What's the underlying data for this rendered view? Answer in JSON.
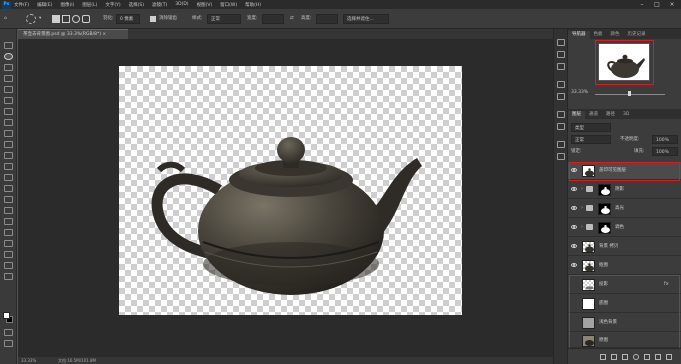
{
  "app": {
    "logo": "Ps",
    "menu": [
      "文件(F)",
      "编辑(E)",
      "图像(I)",
      "图层(L)",
      "文字(Y)",
      "选择(S)",
      "滤镜(T)",
      "3D(D)",
      "视图(V)",
      "窗口(W)",
      "帮助(H)"
    ]
  },
  "options_bar": {
    "feather_label": "羽化:",
    "feather_value": "0 像素",
    "antialias_label": "消除锯齿",
    "style_label": "样式:",
    "style_value": "正常",
    "width_label": "宽度:",
    "height_label": "高度:",
    "select_mask_button": "选择并遮住..."
  },
  "document": {
    "tab_title": "茶壶去背景图.psd @ 33.3%(RGB/8*) ×",
    "status_zoom": "33.33%",
    "status_doc": "文档:16.5M/101.8M"
  },
  "navigator": {
    "tabs": [
      "导航器",
      "色板",
      "颜色",
      "历史记录"
    ],
    "zoom": "33.33%"
  },
  "layers_panel": {
    "tabs": [
      "图层",
      "通道",
      "路径",
      "3D"
    ],
    "kind_filter": "类型",
    "blend_mode": "正常",
    "opacity_label": "不透明度:",
    "opacity_value": "100%",
    "lock_label": "锁定:",
    "fill_label": "填充:",
    "fill_value": "100%",
    "layers": [
      {
        "name": "盖印可见图层",
        "visible": true,
        "active": true
      },
      {
        "name": "阴影",
        "visible": true,
        "group": true
      },
      {
        "name": "高光",
        "visible": true,
        "group": true
      },
      {
        "name": "调色",
        "visible": true,
        "group": true
      },
      {
        "name": "背景 拷贝",
        "visible": true
      },
      {
        "name": "抠图",
        "visible": true
      },
      {
        "name": "投影",
        "visible": false
      },
      {
        "name": "底图",
        "visible": false
      },
      {
        "name": "浅色背景",
        "visible": false
      },
      {
        "name": "原图",
        "visible": false
      }
    ]
  },
  "colors": {
    "highlight": "#e0191d",
    "workspace": "#2b2b2b",
    "panel": "#3c3c3c"
  }
}
